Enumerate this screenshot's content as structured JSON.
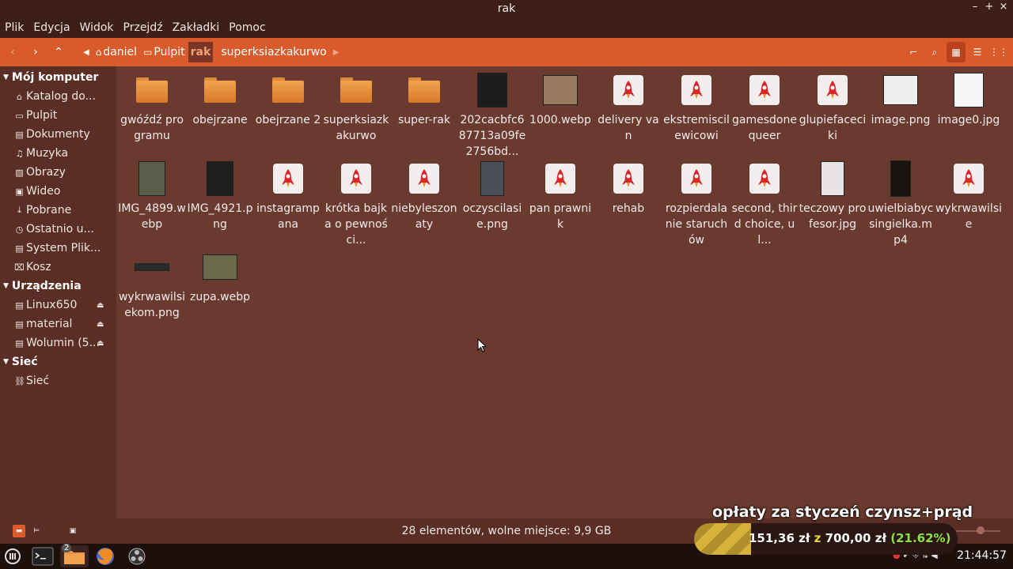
{
  "window": {
    "title": "rak"
  },
  "menu": [
    "Plik",
    "Edycja",
    "Widok",
    "Przejdź",
    "Zakładki",
    "Pomoc"
  ],
  "breadcrumb": [
    "daniel",
    "Pulpit",
    "rak",
    "superksiazkakurwo"
  ],
  "sidebar": {
    "sections": [
      {
        "title": "Mój komputer",
        "items": [
          {
            "label": "Katalog do...",
            "icon": "home-icon"
          },
          {
            "label": "Pulpit",
            "icon": "folder-icon"
          },
          {
            "label": "Dokumenty",
            "icon": "document-icon"
          },
          {
            "label": "Muzyka",
            "icon": "music-icon"
          },
          {
            "label": "Obrazy",
            "icon": "image-icon"
          },
          {
            "label": "Wideo",
            "icon": "video-icon"
          },
          {
            "label": "Pobrane",
            "icon": "download-icon"
          },
          {
            "label": "Ostatnio u...",
            "icon": "recent-icon"
          },
          {
            "label": "System Plik...",
            "icon": "drive-icon"
          },
          {
            "label": "Kosz",
            "icon": "trash-icon"
          }
        ]
      },
      {
        "title": "Urządzenia",
        "items": [
          {
            "label": "Linux650",
            "icon": "drive-icon",
            "eject": true
          },
          {
            "label": "material",
            "icon": "drive-icon",
            "eject": true
          },
          {
            "label": "Wolumin (5...",
            "icon": "drive-icon",
            "eject": true
          }
        ]
      },
      {
        "title": "Sieć",
        "items": [
          {
            "label": "Sieć",
            "icon": "network-icon"
          }
        ]
      }
    ]
  },
  "files": [
    {
      "name": "gwóźdź programu",
      "type": "folder"
    },
    {
      "name": "obejrzane",
      "type": "folder"
    },
    {
      "name": "obejrzane 2",
      "type": "folder"
    },
    {
      "name": "superksiazkakurwo",
      "type": "folder"
    },
    {
      "name": "super-rak",
      "type": "folder"
    },
    {
      "name": "202cacbfc687713a09fe2756bd...",
      "type": "image"
    },
    {
      "name": "1000.webp",
      "type": "image"
    },
    {
      "name": "delivery van",
      "type": "rocket"
    },
    {
      "name": "ekstremiscilewicowi",
      "type": "rocket"
    },
    {
      "name": "gamesdonequeer",
      "type": "rocket"
    },
    {
      "name": "glupiefaceciki",
      "type": "rocket"
    },
    {
      "name": "image.png",
      "type": "image"
    },
    {
      "name": "image0.jpg",
      "type": "image"
    },
    {
      "name": "IMG_4899.webp",
      "type": "image"
    },
    {
      "name": "IMG_4921.png",
      "type": "image"
    },
    {
      "name": "instagrampana",
      "type": "rocket"
    },
    {
      "name": "krótka bajka o pewności...",
      "type": "rocket"
    },
    {
      "name": "niebyleszonaty",
      "type": "rocket"
    },
    {
      "name": "oczyscilasie.png",
      "type": "image"
    },
    {
      "name": "pan prawnik",
      "type": "rocket"
    },
    {
      "name": "rehab",
      "type": "rocket"
    },
    {
      "name": "rozpierdalanie staruchów",
      "type": "rocket"
    },
    {
      "name": "second, third choice, ul...",
      "type": "rocket"
    },
    {
      "name": "teczowy profesor.jpg",
      "type": "image"
    },
    {
      "name": "uwielbiabycsingielka.mp4",
      "type": "video"
    },
    {
      "name": "wykrwawilsie",
      "type": "rocket"
    },
    {
      "name": "wykrwawilsiekom.png",
      "type": "image"
    },
    {
      "name": "zupa.webp",
      "type": "image"
    }
  ],
  "status": {
    "text": "28 elementów, wolne miejsce: 9,9 GB"
  },
  "overlay": {
    "title": "opłaty za styczeń czynsz+prąd",
    "current": "151,36 zł",
    "sep": "z",
    "total": "700,00 zł",
    "percent": "(21.62%)",
    "fraction": 0.2162
  },
  "taskbar": {
    "clock": "21:44:57",
    "badge": "2"
  },
  "colors": {
    "accent": "#d95a2a",
    "background": "#6b3a2f",
    "sidebar": "#5a2e25"
  }
}
